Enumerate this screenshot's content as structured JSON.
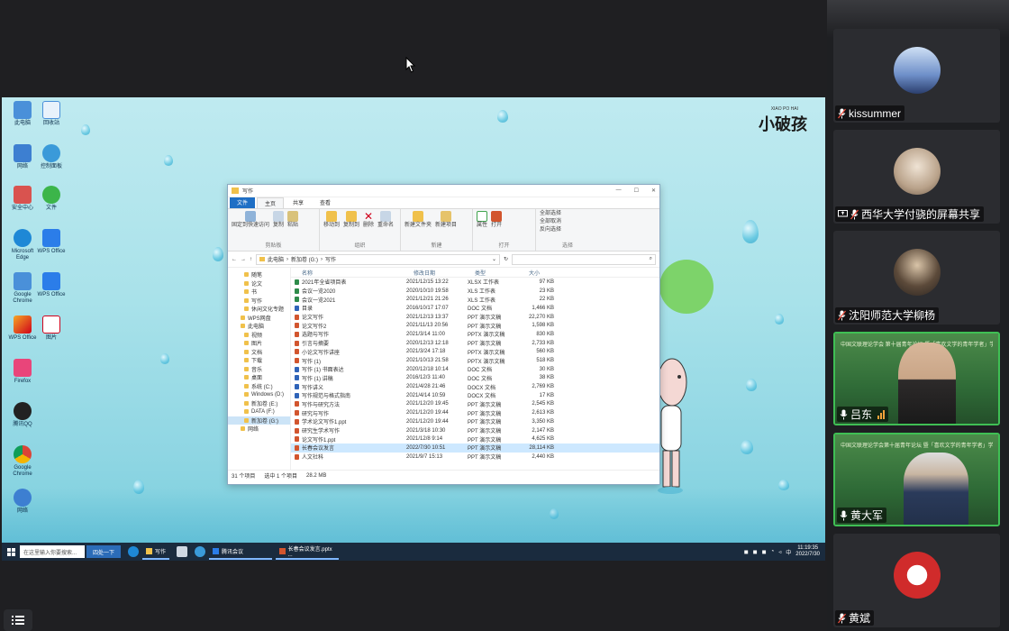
{
  "desktop": {
    "brand": "小破孩",
    "brand_small": "XIAO PO HAI",
    "icons": [
      "此电脑",
      "回收站",
      "网络",
      "控制面板",
      "Microsoft Edge",
      "WPS Office",
      "安全中心",
      "文件",
      "Google Chrome",
      "腾讯QQ",
      "图片",
      "Firefox"
    ]
  },
  "explorer": {
    "title": "写作",
    "tabs": [
      "文件",
      "主页",
      "共享",
      "查看"
    ],
    "ribbon_groups": [
      {
        "name": "剪贴板",
        "buttons": [
          "固定到快速访问",
          "复制",
          "粘贴",
          "剪切",
          "复制路径",
          "粘贴快捷方式"
        ]
      },
      {
        "name": "组织",
        "buttons": [
          "移动到",
          "复制到",
          "删除",
          "重命名"
        ]
      },
      {
        "name": "新建",
        "buttons": [
          "新建文件夹",
          "新建项目",
          "轻松访问"
        ]
      },
      {
        "name": "打开",
        "buttons": [
          "属性",
          "打开",
          "编辑",
          "历史记录"
        ]
      },
      {
        "name": "选择",
        "buttons": [
          "全部选择",
          "全部取消",
          "反向选择"
        ]
      }
    ],
    "path": [
      "此电脑",
      "新加卷 (G:)",
      "写作"
    ],
    "search_placeholder": "",
    "columns": [
      "名称",
      "修改日期",
      "类型",
      "大小"
    ],
    "nav": [
      {
        "label": "随笔",
        "sub": true
      },
      {
        "label": "论文",
        "sub": true
      },
      {
        "label": "书",
        "sub": true
      },
      {
        "label": "写作",
        "sub": true
      },
      {
        "label": "休闲文化专题",
        "sub": true
      },
      {
        "label": "WPS网盘",
        "sub": false
      },
      {
        "label": "此电脑",
        "sub": false
      },
      {
        "label": "视频",
        "sub": true
      },
      {
        "label": "图片",
        "sub": true
      },
      {
        "label": "文档",
        "sub": true
      },
      {
        "label": "下载",
        "sub": true
      },
      {
        "label": "音乐",
        "sub": true
      },
      {
        "label": "桌面",
        "sub": true
      },
      {
        "label": "系统 (C:)",
        "sub": true
      },
      {
        "label": "Windows (D:)",
        "sub": true
      },
      {
        "label": "新加卷 (E:)",
        "sub": true
      },
      {
        "label": "DATA (F:)",
        "sub": true
      },
      {
        "label": "新加卷 (G:)",
        "sub": true,
        "selected": true
      },
      {
        "label": "网络",
        "sub": false
      }
    ],
    "files": [
      {
        "name": "2021年全省项目表",
        "date": "2021/12/15 13:22",
        "type": "XLSX 工作表",
        "size": "97 KB",
        "color": "#2e8b4a"
      },
      {
        "name": "会议一览2020",
        "date": "2020/10/10 19:58",
        "type": "XLS 工作表",
        "size": "23 KB",
        "color": "#2e8b4a"
      },
      {
        "name": "会议一览2021",
        "date": "2021/12/21 21:26",
        "type": "XLS 工作表",
        "size": "22 KB",
        "color": "#2e8b4a"
      },
      {
        "name": "目录",
        "date": "2016/10/17 17:07",
        "type": "DOC 文档",
        "size": "1,466 KB",
        "color": "#2f63b8"
      },
      {
        "name": "论文写作",
        "date": "2021/12/13 13:37",
        "type": "PPT 演示文稿",
        "size": "22,270 KB",
        "color": "#d2552e"
      },
      {
        "name": "论文写作2",
        "date": "2021/11/13 20:56",
        "type": "PPT 演示文稿",
        "size": "1,598 KB",
        "color": "#d2552e"
      },
      {
        "name": "选题与写作",
        "date": "2021/3/14 11:00",
        "type": "PPTX 演示文稿",
        "size": "830 KB",
        "color": "#d2552e"
      },
      {
        "name": "引言与摘要",
        "date": "2020/12/13 12:18",
        "type": "PPT 演示文稿",
        "size": "2,733 KB",
        "color": "#d2552e"
      },
      {
        "name": "小论文写作讲座",
        "date": "2021/3/24 17:18",
        "type": "PPTX 演示文稿",
        "size": "560 KB",
        "color": "#d2552e"
      },
      {
        "name": "写作 (1)",
        "date": "2021/10/13 21:58",
        "type": "PPTX 演示文稿",
        "size": "518 KB",
        "color": "#d2552e"
      },
      {
        "name": "写作 (1) 书面表达",
        "date": "2020/12/18 10:14",
        "type": "DOC 文档",
        "size": "30 KB",
        "color": "#2f63b8"
      },
      {
        "name": "写作 (1) 讲稿",
        "date": "2016/12/3 11:40",
        "type": "DOC 文档",
        "size": "38 KB",
        "color": "#2f63b8"
      },
      {
        "name": "写作讲义",
        "date": "2021/4/28 21:46",
        "type": "DOCX 文档",
        "size": "2,769 KB",
        "color": "#2f63b8"
      },
      {
        "name": "写作规范与格式指南",
        "date": "2021/4/14 10:59",
        "type": "DOCX 文档",
        "size": "17 KB",
        "color": "#2f63b8"
      },
      {
        "name": "写作与研究方法",
        "date": "2021/12/20 19:45",
        "type": "PPT 演示文稿",
        "size": "2,545 KB",
        "color": "#d2552e"
      },
      {
        "name": "研究与写作",
        "date": "2021/12/20 19:44",
        "type": "PPT 演示文稿",
        "size": "2,613 KB",
        "color": "#d2552e"
      },
      {
        "name": "学术论文写作1.ppt",
        "date": "2021/12/20 19:44",
        "type": "PPT 演示文稿",
        "size": "3,350 KB",
        "color": "#d2552e"
      },
      {
        "name": "研究生学术写作",
        "date": "2021/3/18 10:30",
        "type": "PPT 演示文稿",
        "size": "2,147 KB",
        "color": "#d2552e"
      },
      {
        "name": "论文写作1.ppt",
        "date": "2021/12/8 9:14",
        "type": "PPT 演示文稿",
        "size": "4,625 KB",
        "color": "#d2552e"
      },
      {
        "name": "长春会议发言",
        "date": "2022/7/30 10:51",
        "type": "PPT 演示文稿",
        "size": "28,114 KB",
        "color": "#d2552e",
        "selected": true
      },
      {
        "name": "人文社科",
        "date": "2021/9/7 15:13",
        "type": "PPT 演示文稿",
        "size": "2,440 KB",
        "color": "#d2552e"
      }
    ],
    "status_count": "31 个项目",
    "status_selected": "选中 1 个项目",
    "status_size": "28.2 MB"
  },
  "taskbar": {
    "search_placeholder": "在这里输入你要搜索...",
    "news": "四处一下",
    "apps": [
      {
        "label": "写作",
        "color": "#f0c14b"
      },
      {
        "label": "腾讯会议",
        "color": "#2b7de9"
      },
      {
        "label": "长春会议发言.pptx ...",
        "color": "#d2552e"
      }
    ],
    "tray_lang": "中",
    "clock_time": "11:19:35",
    "clock_date": "2022/7/30"
  },
  "participants": [
    {
      "name": "kissummer",
      "type": "avatar",
      "share": false,
      "signal": false
    },
    {
      "name": "西华大学付骁的屏幕共享",
      "type": "avatar",
      "share": true,
      "signal": false
    },
    {
      "name": "沈阳师范大学柳杨",
      "type": "avatar",
      "share": false,
      "signal": false
    },
    {
      "name": "吕东",
      "type": "video",
      "share": false,
      "signal": true,
      "banner": "中国文联理论学会 第十届青年论坛 暨「喜欢文学的青年学者」学术研讨会"
    },
    {
      "name": "黄大军",
      "type": "video",
      "share": false,
      "signal": false,
      "banner": "中国文联理论学会第十届青年论坛 暨「喜欢文学的青年学者」学术研讨会"
    },
    {
      "name": "黄斌",
      "type": "avatar",
      "share": false,
      "signal": false
    }
  ],
  "colors": {
    "accent": "#3fbf54",
    "taskbar": "#1a2b3e",
    "selection": "#cde8ff"
  }
}
